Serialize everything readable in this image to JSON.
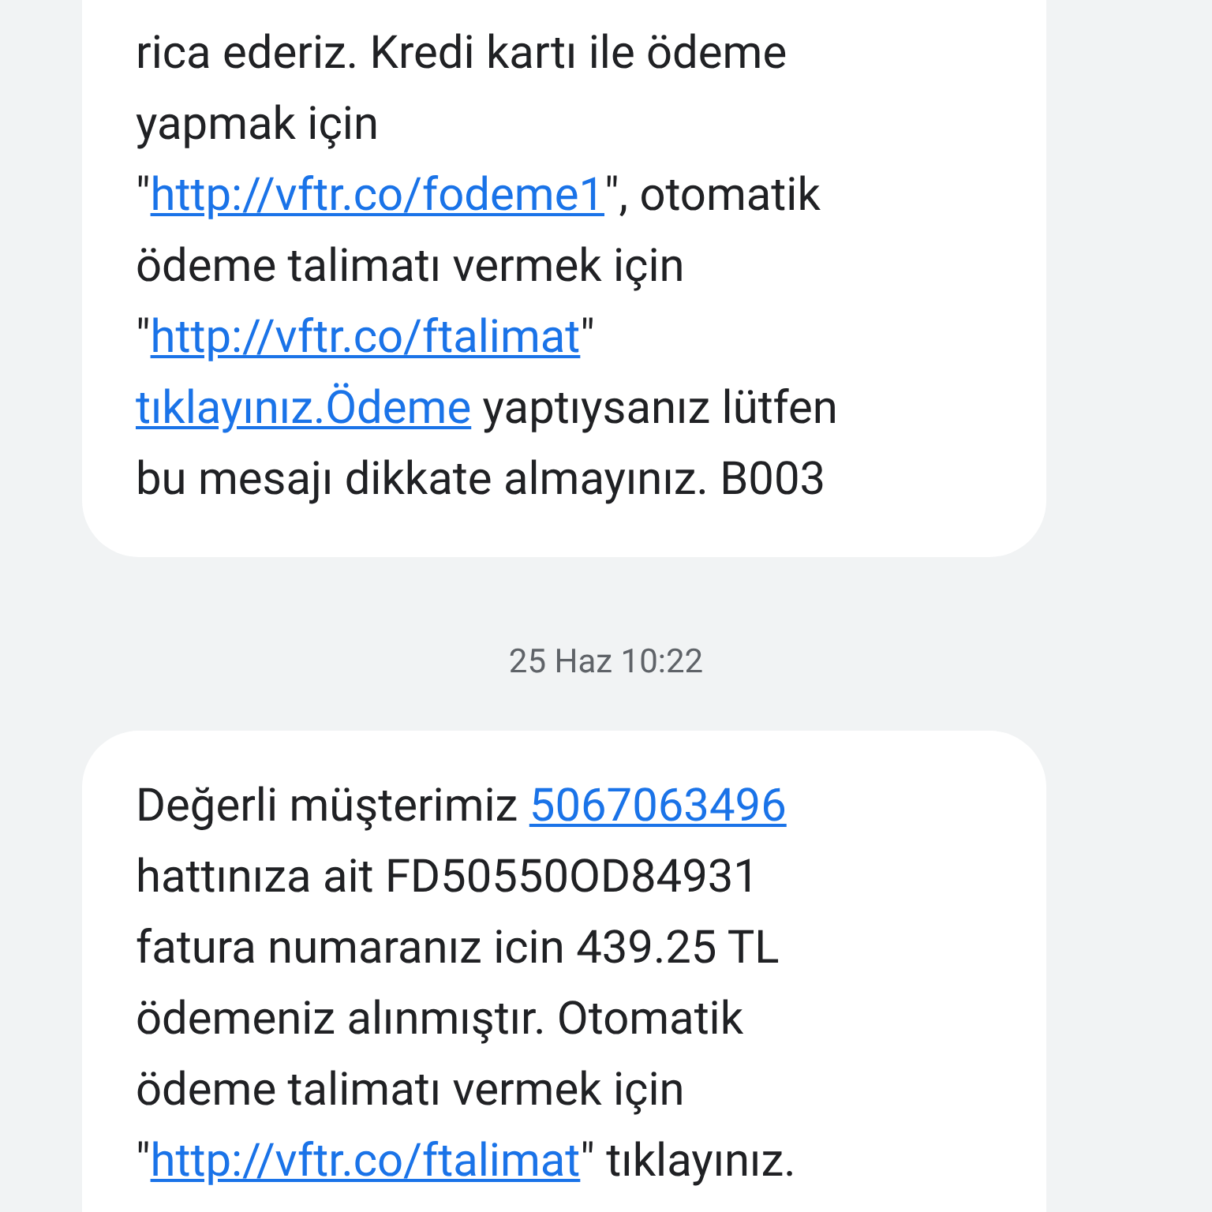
{
  "messages": [
    {
      "parts": [
        {
          "kind": "text",
          "text": "rica ederiz. Kredi kartı ile ödeme"
        },
        {
          "kind": "break"
        },
        {
          "kind": "text",
          "text": "yapmak için"
        },
        {
          "kind": "break"
        },
        {
          "kind": "text",
          "text": "\""
        },
        {
          "kind": "link",
          "text": "http://vftr.co/fodeme1"
        },
        {
          "kind": "text",
          "text": "\", otomatik"
        },
        {
          "kind": "break"
        },
        {
          "kind": "text",
          "text": "ödeme talimatı vermek için"
        },
        {
          "kind": "break"
        },
        {
          "kind": "text",
          "text": "\""
        },
        {
          "kind": "link",
          "text": "http://vftr.co/ftalimat"
        },
        {
          "kind": "text",
          "text": "\""
        },
        {
          "kind": "break"
        },
        {
          "kind": "link",
          "text": "tıklayınız.Ödeme"
        },
        {
          "kind": "text",
          "text": " yaptıysanız lütfen"
        },
        {
          "kind": "break"
        },
        {
          "kind": "text",
          "text": "bu mesajı dikkate almayınız. B003"
        }
      ]
    },
    {
      "timestamp": "25 Haz 10:22",
      "parts": [
        {
          "kind": "text",
          "text": "Değerli müşterimiz "
        },
        {
          "kind": "link",
          "text": "5067063496"
        },
        {
          "kind": "break"
        },
        {
          "kind": "text",
          "text": "hattınıza ait FD50550OD84931"
        },
        {
          "kind": "break"
        },
        {
          "kind": "text",
          "text": "fatura numaranız icin 439.25 TL"
        },
        {
          "kind": "break"
        },
        {
          "kind": "text",
          "text": "ödemeniz alınmıştır. Otomatik"
        },
        {
          "kind": "break"
        },
        {
          "kind": "text",
          "text": "ödeme talimatı vermek için"
        },
        {
          "kind": "break"
        },
        {
          "kind": "text",
          "text": "\""
        },
        {
          "kind": "link",
          "text": "http://vftr.co/ftalimat"
        },
        {
          "kind": "text",
          "text": "\" tıklayınız."
        }
      ]
    }
  ]
}
